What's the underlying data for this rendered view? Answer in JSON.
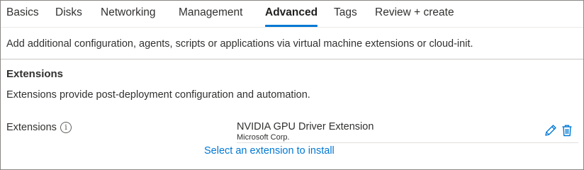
{
  "tabs": [
    {
      "label": "Basics",
      "active": false
    },
    {
      "label": "Disks",
      "active": false
    },
    {
      "label": "Networking",
      "active": false
    },
    {
      "label": "Management",
      "active": false
    },
    {
      "label": "Advanced",
      "active": true
    },
    {
      "label": "Tags",
      "active": false
    },
    {
      "label": "Review + create",
      "active": false
    }
  ],
  "intro_text": "Add additional configuration, agents, scripts or applications via virtual machine extensions or cloud-init.",
  "extensions_section": {
    "title": "Extensions",
    "description": "Extensions provide post-deployment configuration and automation.",
    "field_label": "Extensions",
    "info_glyph": "i",
    "extension": {
      "name": "NVIDIA GPU Driver Extension",
      "publisher": "Microsoft Corp."
    },
    "add_link": "Select an extension to install"
  },
  "icons": {
    "info": "info-icon",
    "edit": "pencil-icon",
    "delete": "trash-icon"
  },
  "colors": {
    "accent": "#0078d4",
    "text": "#323130",
    "border": "#8a8886"
  }
}
